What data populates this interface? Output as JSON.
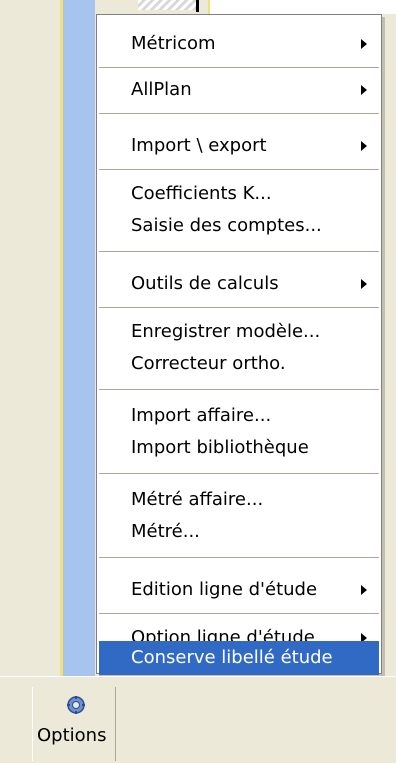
{
  "menu": {
    "items": [
      {
        "label": "Métricom",
        "submenu": true
      },
      {
        "label": "AllPlan",
        "submenu": true
      },
      {
        "label": "Import \\ export",
        "submenu": true
      },
      {
        "label": "Coefficients K...",
        "submenu": false
      },
      {
        "label": "Saisie des comptes...",
        "submenu": false
      },
      {
        "label": "Outils de calculs",
        "submenu": true
      },
      {
        "label": "Enregistrer modèle...",
        "submenu": false
      },
      {
        "label": "Correcteur ortho.",
        "submenu": false
      },
      {
        "label": "Import affaire...",
        "submenu": false
      },
      {
        "label": "Import bibliothèque",
        "submenu": false
      },
      {
        "label": "Métré affaire...",
        "submenu": false
      },
      {
        "label": "Métré...",
        "submenu": false
      },
      {
        "label": "Edition ligne d'étude",
        "submenu": true
      },
      {
        "label": "Option ligne d'étude",
        "submenu": true
      },
      {
        "label": "Conserve libellé étude",
        "submenu": false,
        "highlighted": true
      }
    ],
    "highlight_color": "#316ac5"
  },
  "toolbar": {
    "options_label": "Options",
    "options_icon": "options-gear-icon"
  }
}
